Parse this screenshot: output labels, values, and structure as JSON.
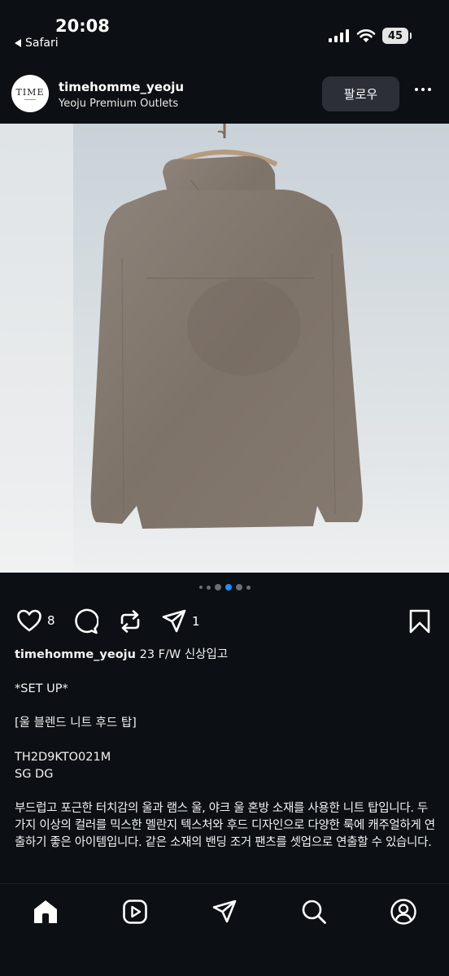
{
  "status": {
    "time": "20:08",
    "back_label": "Safari",
    "battery": "45"
  },
  "post": {
    "username": "timehomme_yeoju",
    "location": "Yeoju Premium Outlets",
    "follow_label": "팔로우",
    "avatar_text": "TIME",
    "likes": "8",
    "shares": "1",
    "carousel": {
      "total": 6,
      "active": 4
    }
  },
  "caption": {
    "username": "timehomme_yeoju",
    "headline": "23 F/W 신상입고",
    "setup": "*SET UP*",
    "product_name": "[울 블렌드 니트 후드 탑]",
    "code": "TH2D9KTO021M",
    "color": "SG DG",
    "description": "부드럽고 포근한 터치감의 울과 램스 울, 야크 울 혼방 소재를 사용한 니트 탑입니다. 두 가지 이상의 컬러를 믹스한 멜란지 텍스처와 후드 디자인으로 다양한 룩에 캐주얼하게 연출하기 좋은 아이템입니다. 같은 소재의 밴딩 조거 팬츠를 셋업으로 연출할 수 있습니다."
  },
  "nav": [
    "home-icon",
    "reels-icon",
    "send-icon",
    "search-icon",
    "profile-icon"
  ],
  "colors": {
    "background": "#0c1014",
    "button": "#2c3036",
    "garment": "#857a6f"
  }
}
